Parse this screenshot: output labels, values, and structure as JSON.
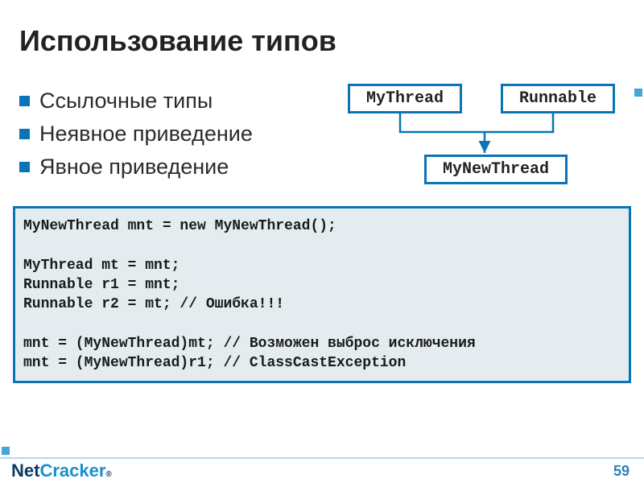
{
  "slide": {
    "title": "Использование типов",
    "bullets": [
      "Ссылочные типы",
      "Неявное приведение",
      "Явное приведение"
    ],
    "diagram": {
      "box_mythread": "MyThread",
      "box_runnable": "Runnable",
      "box_mynew": "MyNewThread"
    },
    "code": "MyNewThread mnt = new MyNewThread();\n\nMyThread mt = mnt;\nRunnable r1 = mnt;\nRunnable r2 = mt; // Ошибка!!!\n\nmnt = (MyNewThread)mt; // Возможен выброс исключения\nmnt = (MyNewThread)r1; // ClassCastException",
    "footer": {
      "logo_net": "Net",
      "logo_cracker": "Cracker",
      "logo_reg": "®",
      "page_number": "59"
    }
  }
}
